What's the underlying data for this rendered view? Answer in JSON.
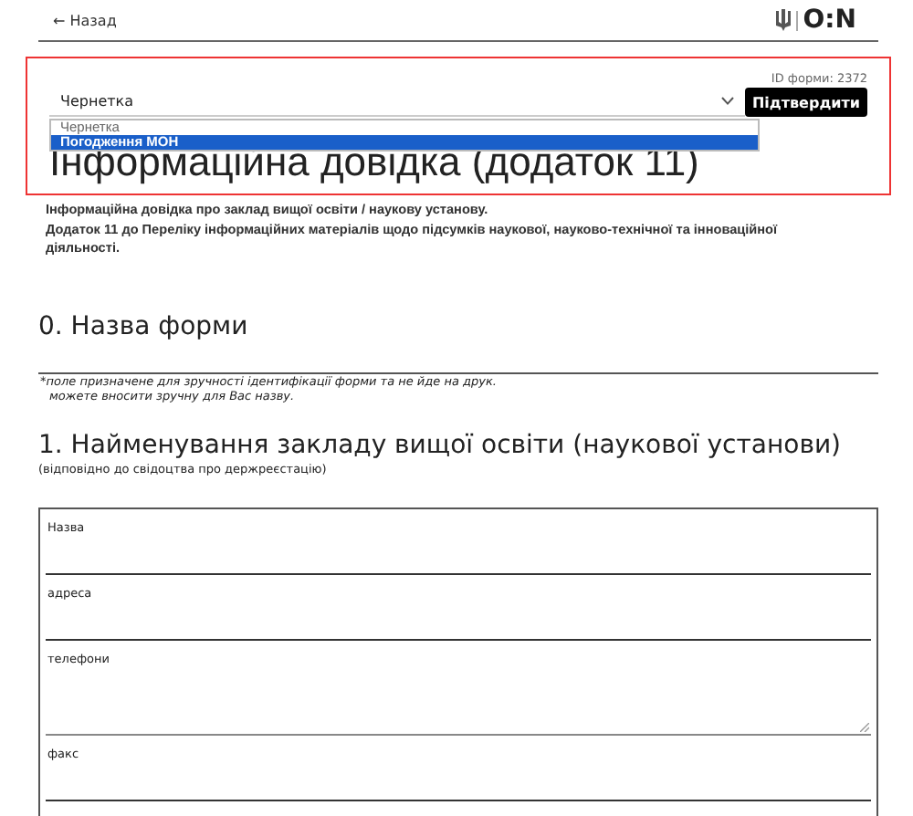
{
  "header": {
    "back_link": "← Назад",
    "logo_text": "O:N"
  },
  "status_panel": {
    "form_id": "ID форми: 2372",
    "select_value": "Чернетка",
    "options": [
      {
        "label": "Чернетка",
        "selected": false
      },
      {
        "label": "Погодження МОН",
        "selected": true
      }
    ],
    "confirm_button": "Підтвердити"
  },
  "title": "Інформаційна довідка (додаток 11)",
  "description": [
    "Інформаційна довідка про заклад вищої освіти / наукову установу.",
    "Додаток 11 до Переліку інформаційних матеріалів щодо підсумків наукової, науково-технічної та інноваційної діяльності."
  ],
  "section_0": {
    "heading": "0. Назва форми",
    "notes": [
      "*поле призначене для зручності ідентифікації форми та не йде на друк.",
      "можете вносити зручну для Вас назву."
    ]
  },
  "section_1": {
    "heading": "1. Найменування закладу вищої освіти (наукової установи)",
    "subheading": "(відповідно до свідоцтва про держреєстацію)",
    "fields": [
      {
        "label": "Назва",
        "kind": "input"
      },
      {
        "label": "адреса",
        "kind": "input"
      },
      {
        "label": "телефони",
        "kind": "textarea"
      },
      {
        "label": "факс",
        "kind": "input"
      }
    ]
  }
}
